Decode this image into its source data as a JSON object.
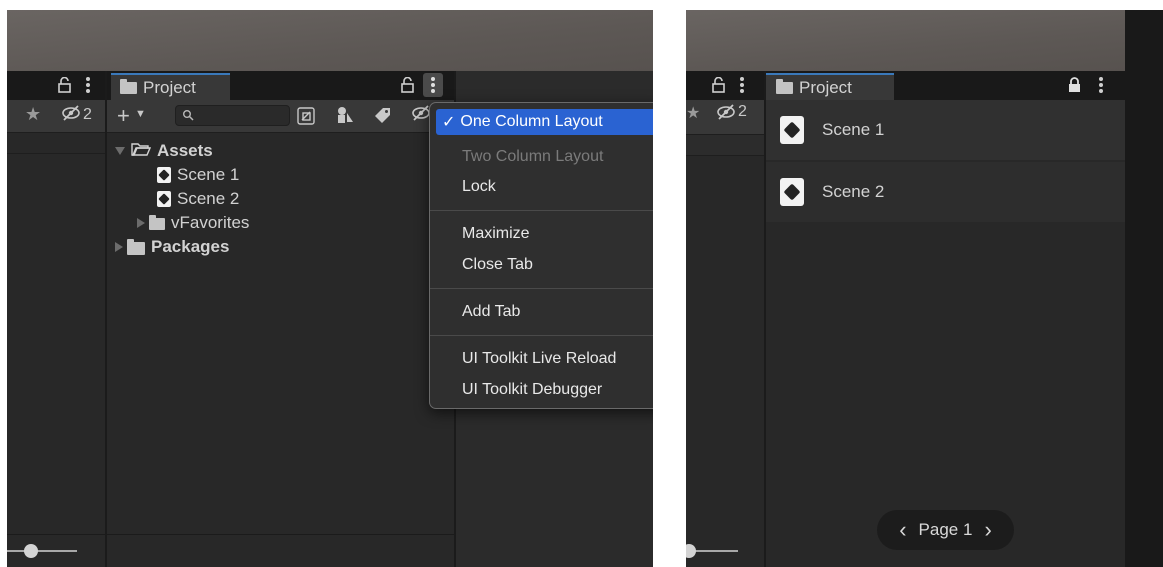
{
  "left": {
    "header": {
      "lock_icon": "lock-open-icon",
      "menu_icon": "kebab-menu-icon",
      "favorites_icon": "star-icon",
      "hidden_count": "2",
      "hidden_icon": "eye-off-icon"
    },
    "project_tab": {
      "label": "Project",
      "icon": "folder-icon"
    },
    "toolbar": {
      "add_icon": "plus-icon",
      "search_placeholder": "",
      "search_icon": "search-icon"
    },
    "tree": {
      "assets": "Assets",
      "scene1": "Scene 1",
      "scene2": "Scene 2",
      "vfavorites": "vFavorites",
      "packages": "Packages"
    },
    "context_menu": {
      "items": [
        {
          "label": "One Column Layout",
          "checked": true,
          "enabled": true
        },
        {
          "label": "Two Column Layout",
          "enabled": false
        },
        {
          "label": "Lock",
          "enabled": true
        },
        {
          "label": "Maximize",
          "enabled": true
        },
        {
          "label": "Close Tab",
          "enabled": true
        },
        {
          "label": "Add Tab",
          "enabled": true
        },
        {
          "label": "UI Toolkit Live Reload",
          "enabled": true
        },
        {
          "label": "UI Toolkit Debugger",
          "enabled": true
        }
      ],
      "check_mark": "✓"
    }
  },
  "right": {
    "header": {
      "hidden_count": "2"
    },
    "project_tab": {
      "label": "Project"
    },
    "items": [
      "Scene 1",
      "Scene 2"
    ],
    "pager": {
      "label": "Page 1",
      "prev": "‹",
      "next": "›"
    }
  },
  "colors": {
    "accent": "#2a63d2",
    "tab_underline": "#3a79bb",
    "panel_bg": "#282828"
  }
}
